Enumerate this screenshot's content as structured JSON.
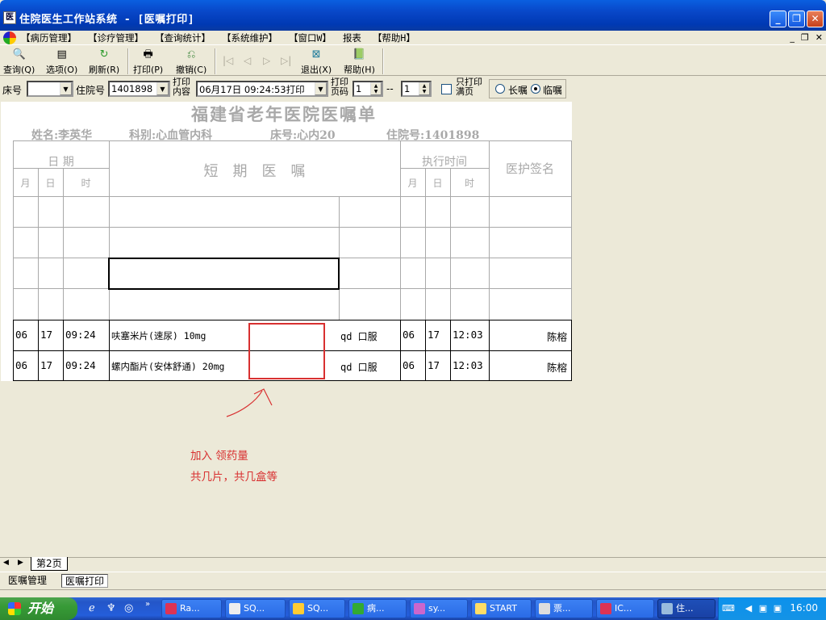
{
  "window": {
    "title": "住院医生工作站系统 - [医嘱打印]"
  },
  "menu": {
    "items": [
      "【病历管理】",
      "【诊疗管理】",
      "【查询统计】",
      "【系统维护】",
      "【窗口W】",
      "报表",
      "【帮助H】"
    ]
  },
  "toolbar": {
    "query": "查询(Q)",
    "options": "选项(O)",
    "refresh": "刷新(R)",
    "print": "打印(P)",
    "cancel": "撤销(C)",
    "exit": "退出(X)",
    "help": "帮助(H)"
  },
  "filter": {
    "bed_label": "床号",
    "bed_value": "",
    "admission_label": "住院号",
    "admission_value": "1401898",
    "print_content_label_1": "打印",
    "print_content_label_2": "内容",
    "print_content_value": "06月17日 09:24:53打印",
    "page_label_1": "打印",
    "page_label_2": "页码",
    "page_from": "1",
    "page_sep": "--",
    "page_to": "1",
    "full_page_label_1": "只打印",
    "full_page_label_2": "满页",
    "long_term_label": "长嘱",
    "temporary_label": "临嘱",
    "selected": "临嘱"
  },
  "document": {
    "title": "福建省老年医院医嘱单",
    "name": "姓名:李英华",
    "dept": "科别:心血管内科",
    "bed": "床号:心内20",
    "admission": "住院号:1401898",
    "headers": {
      "date": "日 期",
      "month": "月",
      "day": "日",
      "time": "时",
      "orders": "短　期　医　嘱",
      "exec_time": "执行时间",
      "exec_month": "月",
      "exec_day": "日",
      "exec_hour": "时",
      "signature": "医护签名"
    },
    "rows": [
      {
        "month": "06",
        "day": "17",
        "time": "09:24",
        "drug": "呋塞米片(速尿) 10mg",
        "usage": "qd 口服",
        "exec_month": "06",
        "exec_day": "17",
        "exec_time": "12:03",
        "signature": "陈榕"
      },
      {
        "month": "06",
        "day": "17",
        "time": "09:24",
        "drug": "螺内酯片(安体舒通) 20mg",
        "usage": "qd 口服",
        "exec_month": "06",
        "exec_day": "17",
        "exec_time": "12:03",
        "signature": "陈榕"
      }
    ]
  },
  "annotation": {
    "line1": "加入 领药量",
    "line2": "共几片，共几盒等",
    "color": "#d83030"
  },
  "sheet_tab": "第2页",
  "doc_tabs": [
    "医嘱管理",
    "医嘱打印"
  ],
  "taskbar": {
    "start": "开始",
    "tasks": [
      "Ra...",
      "SQ...",
      "SQ...",
      "病...",
      "sy...",
      "START",
      "票...",
      "IC...",
      "住..."
    ],
    "clock": "16:00"
  }
}
